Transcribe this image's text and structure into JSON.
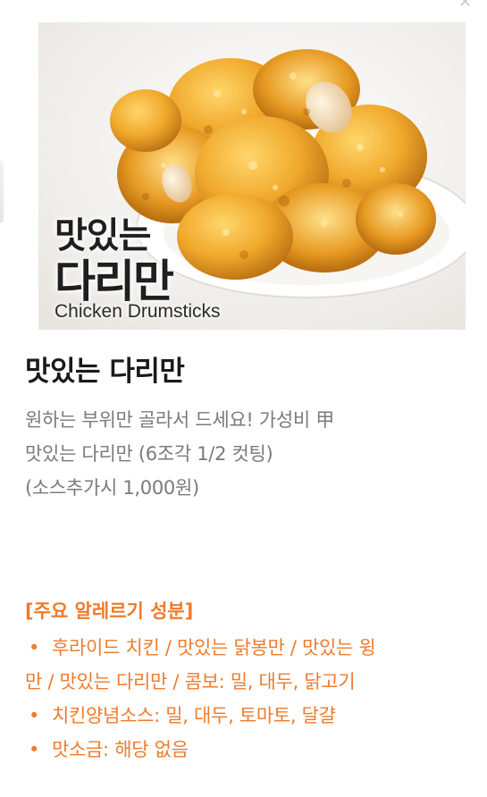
{
  "product": {
    "image_text": {
      "line1": "맛있는",
      "line2": "다리만",
      "english": "Chicken Drumsticks"
    },
    "name": "맛있는 다리만",
    "description_lines": [
      "원하는 부위만 골라서 드세요! 가성비 甲",
      "맛있는 다리만 (6조각 1/2 컷팅)",
      "(소스추가시 1,000원)"
    ]
  },
  "allergens": {
    "heading": "[주요 알레르기 성분]",
    "items": [
      {
        "line1": "후라이드 치킨 / 맛있는 닭봉만 / 맛있는 윙",
        "line2": "만 / 맛있는 다리만 / 콤보: 밀, 대두, 닭고기"
      },
      {
        "line1": "치킨양념소스: 밀, 대두, 토마토, 달걀"
      },
      {
        "line1": "맛소금: 해당 없음"
      }
    ],
    "bullet": "•"
  },
  "colors": {
    "accent": "#ee7b2c",
    "title": "#1a1a1a",
    "description": "#7a7a7a"
  },
  "icons": {
    "close": "close-icon"
  }
}
